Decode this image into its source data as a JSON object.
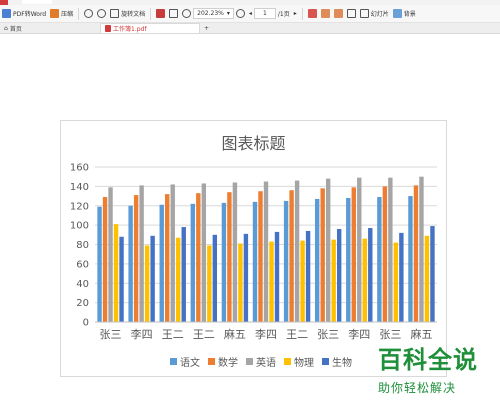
{
  "toolbar": {
    "pdf_to_word": "PDF转Word",
    "compress": "压缩",
    "rotate_doc": "旋转文档",
    "zoom": "202.23%",
    "page_current": "1",
    "page_total": "/1页",
    "slideshow": "幻灯片",
    "background": "背景"
  },
  "tabs": {
    "home": "首页",
    "doc": "工作簿1.pdf",
    "add": "+"
  },
  "chart_data": {
    "type": "bar",
    "title": "图表标题",
    "categories": [
      "张三",
      "李四",
      "王二",
      "王二",
      "麻五",
      "李四",
      "王二",
      "张三",
      "李四",
      "张三",
      "麻五"
    ],
    "ylim": [
      0,
      160
    ],
    "yticks": [
      "0",
      "20",
      "40",
      "60",
      "80",
      "100",
      "120",
      "140",
      "160"
    ],
    "grid": true,
    "legend_position": "bottom",
    "series": [
      {
        "name": "语文",
        "color": "#5b9bd5",
        "values": [
          119,
          120,
          121,
          122,
          123,
          124,
          125,
          127,
          128,
          129,
          130
        ]
      },
      {
        "name": "数学",
        "color": "#ed7d31",
        "values": [
          129,
          131,
          132,
          133,
          134,
          135,
          136,
          138,
          139,
          140,
          141
        ]
      },
      {
        "name": "英语",
        "color": "#a5a5a5",
        "values": [
          139,
          141,
          142,
          143,
          144,
          145,
          146,
          148,
          149,
          149,
          150
        ]
      },
      {
        "name": "物理",
        "color": "#ffc000",
        "values": [
          101,
          79,
          87,
          79,
          81,
          83,
          84,
          85,
          86,
          82,
          89
        ]
      },
      {
        "name": "生物",
        "color": "#4472c4",
        "values": [
          88,
          89,
          98,
          90,
          91,
          93,
          94,
          96,
          97,
          92,
          99
        ]
      }
    ]
  },
  "watermark": {
    "title": "百科全说",
    "subtitle": "助你轻松解决"
  }
}
